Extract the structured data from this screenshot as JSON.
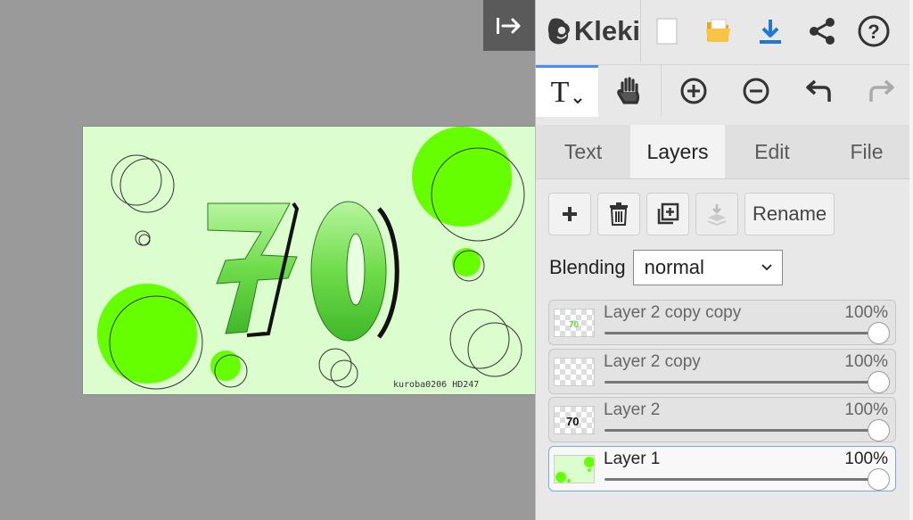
{
  "app": {
    "name": "Kleki"
  },
  "canvas": {
    "artwork_signature": "kuroba0206  HD247",
    "artwork_number": "70"
  },
  "tools": [
    {
      "name": "text-tool",
      "glyph": "T",
      "active": true
    },
    {
      "name": "hand-tool",
      "active": false
    },
    {
      "name": "zoom-in",
      "active": false
    },
    {
      "name": "zoom-out",
      "active": false
    },
    {
      "name": "undo",
      "active": false
    },
    {
      "name": "redo",
      "active": false
    }
  ],
  "tabs": [
    {
      "label": "Text",
      "active": false
    },
    {
      "label": "Layers",
      "active": true
    },
    {
      "label": "Edit",
      "active": false
    },
    {
      "label": "File",
      "active": false
    }
  ],
  "layers_panel": {
    "rename_label": "Rename",
    "blending_label": "Blending",
    "blending_value": "normal",
    "layers": [
      {
        "name": "Layer 2 copy copy",
        "opacity": "100%",
        "opacity_value": 1.0,
        "selected": false
      },
      {
        "name": "Layer 2 copy",
        "opacity": "100%",
        "opacity_value": 1.0,
        "selected": false
      },
      {
        "name": "Layer 2",
        "opacity": "100%",
        "opacity_value": 1.0,
        "selected": false
      },
      {
        "name": "Layer 1",
        "opacity": "100%",
        "opacity_value": 1.0,
        "selected": true
      }
    ]
  },
  "colors": {
    "accent": "#4a8ff0",
    "download": "#1f78d1",
    "folder": "#f0b429",
    "artwork_bg": "#dcfdcd",
    "artwork_green": "#66ff00"
  }
}
